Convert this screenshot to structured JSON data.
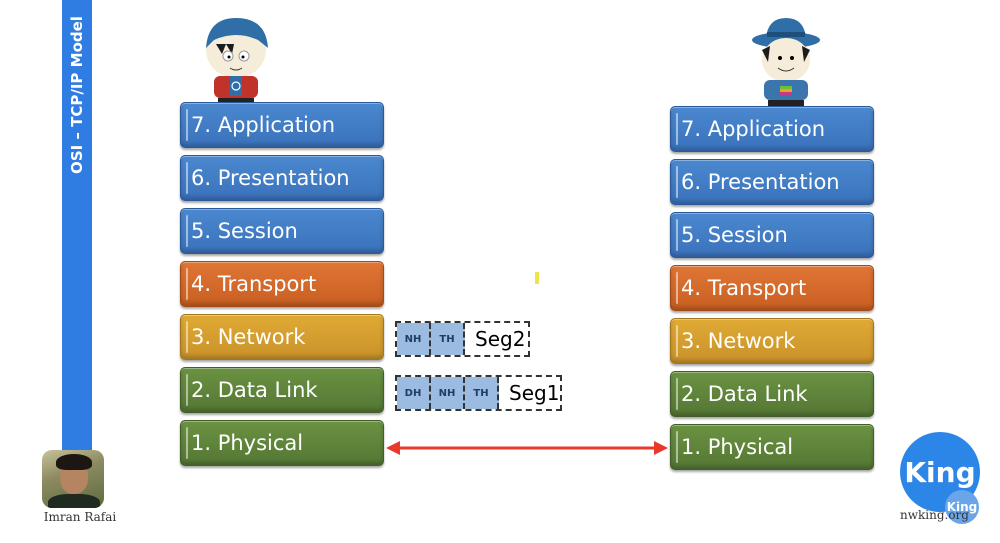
{
  "sidebar": {
    "title": "OSI – TCP/IP Model",
    "color": "#2f7de3"
  },
  "left_stack": {
    "layers": [
      {
        "label": "7. Application",
        "color": "blue"
      },
      {
        "label": "6. Presentation",
        "color": "blue"
      },
      {
        "label": "5. Session",
        "color": "blue"
      },
      {
        "label": "4. Transport",
        "color": "orange"
      },
      {
        "label": "3. Network",
        "color": "yellow"
      },
      {
        "label": "2. Data Link",
        "color": "green"
      },
      {
        "label": "1. Physical",
        "color": "green"
      }
    ]
  },
  "right_stack": {
    "layers": [
      {
        "label": "7. Application",
        "color": "blue"
      },
      {
        "label": "6. Presentation",
        "color": "blue"
      },
      {
        "label": "5. Session",
        "color": "blue"
      },
      {
        "label": "4. Transport",
        "color": "orange"
      },
      {
        "label": "3. Network",
        "color": "yellow"
      },
      {
        "label": "2. Data Link",
        "color": "green"
      },
      {
        "label": "1. Physical",
        "color": "green"
      }
    ]
  },
  "pdus": {
    "network": {
      "headers": [
        "NH",
        "TH"
      ],
      "segment": "Seg2"
    },
    "datalink": {
      "headers": [
        "DH",
        "NH",
        "TH"
      ],
      "segment": "Seg1"
    }
  },
  "link": {
    "icon": "double-arrow-icon",
    "color": "#e8392b"
  },
  "characters": {
    "left": "sender-character",
    "right": "receiver-character"
  },
  "author": {
    "name": "Imran Rafai"
  },
  "logo": {
    "text": "King",
    "small_text": "King",
    "site": "nwking.org",
    "color": "#2c86e8"
  }
}
